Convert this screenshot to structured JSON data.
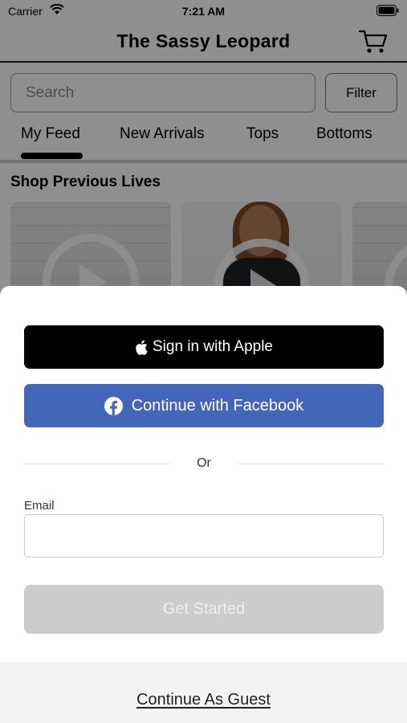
{
  "status_bar": {
    "carrier": "Carrier",
    "time": "7:21 AM"
  },
  "nav": {
    "title": "The Sassy Leopard",
    "cart_icon": "cart-icon"
  },
  "search": {
    "placeholder": "Search",
    "filter_label": "Filter"
  },
  "tabs": [
    {
      "label": "My Feed",
      "selected": true
    },
    {
      "label": "New Arrivals",
      "selected": false
    },
    {
      "label": "Tops",
      "selected": false
    },
    {
      "label": "Bottoms",
      "selected": false
    }
  ],
  "section": {
    "title": "Shop Previous Lives"
  },
  "sheet": {
    "apple_label": "Sign in with Apple",
    "facebook_label": "Continue with Facebook",
    "or_label": "Or",
    "email_label": "Email",
    "email_value": "",
    "get_started_label": "Get Started",
    "guest_label": "Continue As Guest"
  },
  "colors": {
    "facebook": "#4366b8",
    "apple": "#000000",
    "disabled_button": "#cccccc"
  }
}
